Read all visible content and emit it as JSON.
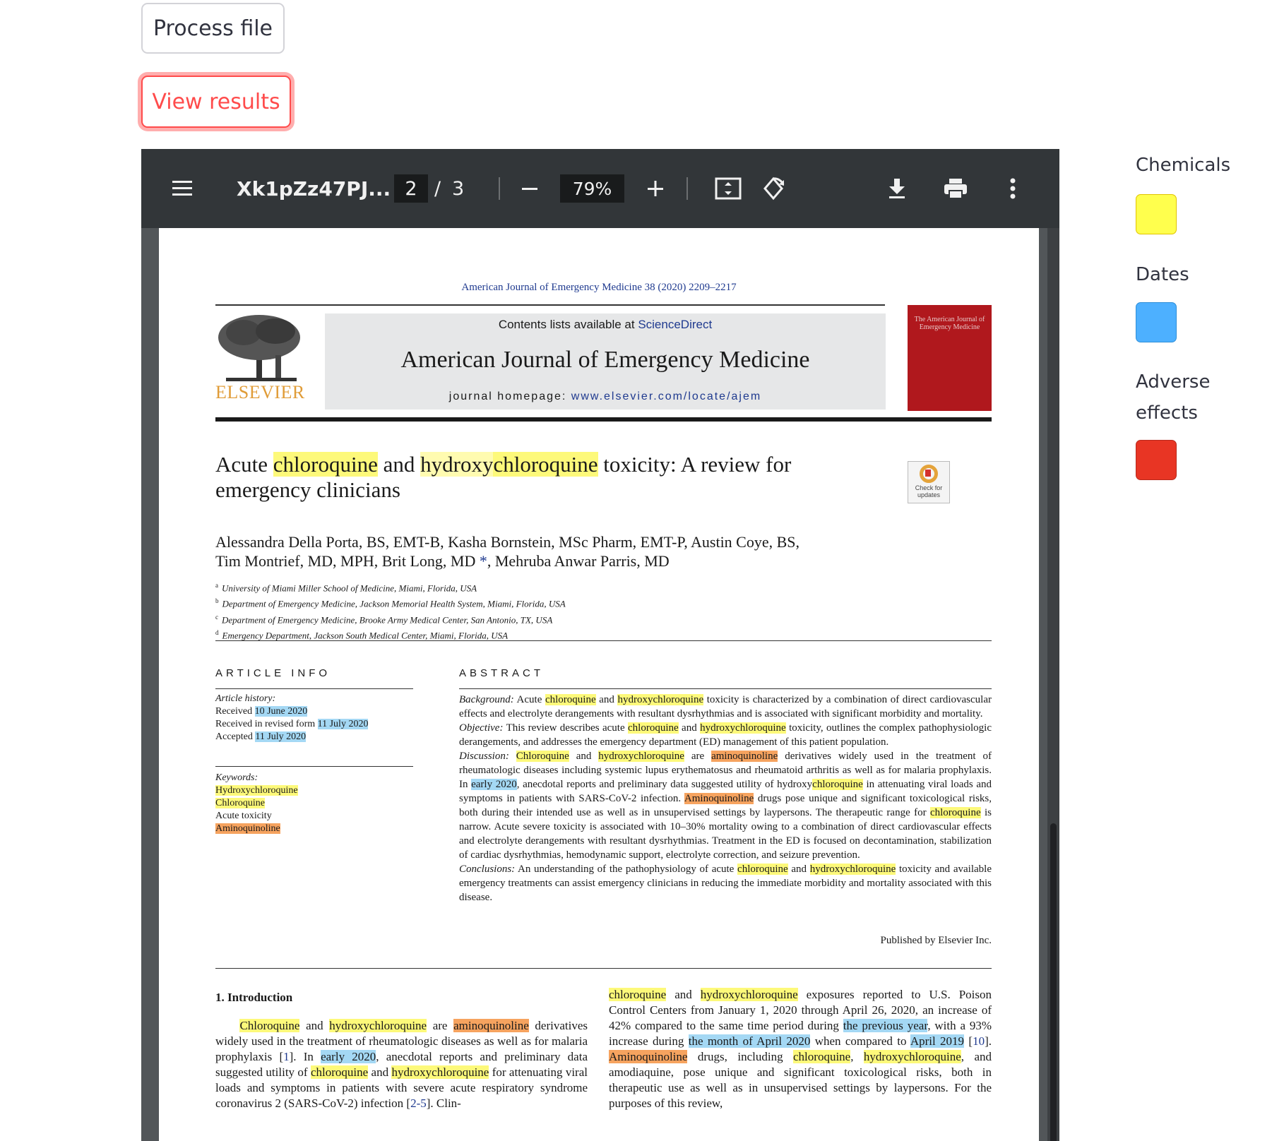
{
  "buttons": {
    "process_file": "Process file",
    "view_results": "View results"
  },
  "viewer": {
    "title": "Xk1pZz47PJ...",
    "current_page": "2",
    "page_separator": "/",
    "total_pages": "3",
    "zoom": "79%",
    "icons": [
      "menu-icon",
      "zoom-out-icon",
      "zoom-in-icon",
      "fit-page-icon",
      "rotate-icon",
      "download-icon",
      "print-icon",
      "more-options-icon"
    ]
  },
  "document": {
    "journal_ref": "American Journal of Emergency Medicine 38 (2020) 2209–2217",
    "contents_prefix": "Contents lists available at ",
    "contents_link": "ScienceDirect",
    "journal_name": "American Journal of Emergency Medicine",
    "homepage_prefix": "journal homepage: ",
    "homepage_link": "www.elsevier.com/locate/ajem",
    "publisher_logo": "ELSEVIER",
    "cover_text": "The American Journal of Emergency Medicine",
    "check_updates": "Check for updates",
    "title": {
      "p1": "Acute ",
      "chem1": "chloroquine",
      "p2": " and ",
      "chem2a": "hydroxy",
      "chem2b": "chloroquine",
      "p3": " toxicity: A review for emergency clinicians"
    },
    "authors": {
      "line1": "Alessandra Della Porta, BS, EMT-B, Kasha Bornstein, MSc Pharm, EMT-P, Austin Coye, BS,",
      "line2": "Tim Montrief, MD, MPH, Brit Long, MD",
      "star": " *",
      "line2b": ", Mehruba Anwar Parris, MD"
    },
    "affiliations": [
      {
        "sup": "a",
        "text": "University of Miami Miller School of Medicine, Miami, Florida, USA"
      },
      {
        "sup": "b",
        "text": "Department of Emergency Medicine, Jackson Memorial Health System, Miami, Florida, USA"
      },
      {
        "sup": "c",
        "text": "Department of Emergency Medicine, Brooke Army Medical Center, San Antonio, TX, USA"
      },
      {
        "sup": "d",
        "text": "Emergency Department, Jackson South Medical Center, Miami, Florida, USA"
      }
    ],
    "article_info_heading": "ARTICLE INFO",
    "abstract_heading": "ABSTRACT",
    "history": {
      "label": "Article history:",
      "received": "Received",
      "received_date": "10 June 2020",
      "revised": "Received in revised form",
      "revised_date": "11 July 2020",
      "accepted": "Accepted",
      "accepted_date": "11 July 2020"
    },
    "keywords": {
      "label": "Keywords:",
      "k1": "Hydroxychloroquine",
      "k2": "Chloroquine",
      "k3": "Acute toxicity",
      "k4": "Aminoquinoline"
    },
    "abstract": {
      "bg_label": "Background:",
      "bg1": " Acute ",
      "bg_c1": "chloroquine",
      "bg2": " and ",
      "bg_c2": "hydroxychloroquine",
      "bg3": " toxicity is characterized by a combination of direct cardiovascular effects and electrolyte derangements with resultant dysrhythmias and is associated with significant morbidity and mortality.",
      "obj_label": "Objective:",
      "obj1": " This review describes acute ",
      "obj_c1": "chloroquine",
      "obj2": " and ",
      "obj_c2": "hydroxychloroquine",
      "obj3": " toxicity, outlines the complex pathophysiologic derangements, and addresses the emergency department (ED) management of this patient population.",
      "disc_label": "Discussion:",
      "disc_c1": "Chloroquine",
      "disc1": " and ",
      "disc_c2": "hydroxychloroquine",
      "disc2": " are ",
      "disc_a1": "aminoquinoline",
      "disc3": " derivatives widely used in the treatment of rheumatologic diseases including systemic lupus erythematosus and rheumatoid arthritis as well as for malaria prophylaxis. In ",
      "disc_d1": "early 2020",
      "disc4": ", anecdotal reports and preliminary data suggested utility of hydroxy",
      "disc_c3": "chloroquine",
      "disc5": " in attenuating viral loads and symptoms in patients with SARS-CoV-2 infection. ",
      "disc_a2": "Aminoquinoline",
      "disc6": " drugs pose unique and significant toxicological risks, both during their intended use as well as in unsupervised settings by laypersons. The therapeutic range for ",
      "disc_c4": "chloroquine",
      "disc7": " is narrow. Acute severe toxicity is associated with 10–30% mortality owing to a combination of direct cardiovascular effects and electrolyte derangements with resultant dysrhythmias. Treatment in the ED is focused on decontamination, stabilization of cardiac dysrhythmias, hemodynamic support, electrolyte correction, and seizure prevention.",
      "conc_label": "Conclusions:",
      "conc1": " An understanding of the pathophysiology of acute ",
      "conc_c1": "chloroquine",
      "conc2": " and ",
      "conc_c2": "hydroxychloroquine",
      "conc3": " toxicity and available emergency treatments can assist emergency clinicians in reducing the immediate morbidity and mortality associated with this disease."
    },
    "published_by": "Published by Elsevier Inc.",
    "intro_heading": "1. Introduction",
    "intro_left": {
      "c1": "Chloroquine",
      "t1": " and ",
      "c2": "hydroxychloroquine",
      "t2": " are ",
      "a1": "aminoquinoline",
      "t3": " derivatives widely used in the treatment of rheumatologic diseases as well as for malaria prophylaxis [",
      "r1": "1",
      "t4": "]. In ",
      "d1": "early 2020",
      "t5": ", anecdotal reports and preliminary data suggested utility of ",
      "c3": "chloroquine",
      "t6": " and ",
      "c4": "hydroxychloroquine",
      "t7": " for attenuating viral loads and symptoms in patients with severe acute respiratory syndrome coronavirus 2 (SARS-CoV-2) infection [",
      "r2": "2-5",
      "t8": "]. Clin-"
    },
    "intro_right": {
      "c1": "chloroquine",
      "t1": " and ",
      "c2": "hydroxychloroquine",
      "t2": " exposures reported to U.S. Poison Control Centers from January 1, 2020 through April 26, 2020, an increase of 42% compared to the same time period during ",
      "d1": "the previous year",
      "t3": ", with a 93% increase during ",
      "d2": "the month of April 2020",
      "t4": " when compared to ",
      "d3": "April 2019",
      "t5": " [",
      "r1": "10",
      "t6": "]. ",
      "a1": "Aminoquinoline",
      "t7": " drugs, including ",
      "c3": "chloroquine",
      "t8": ", ",
      "c4": "hydroxychloroquine",
      "t9": ", and amodiaquine, pose unique and significant toxicological risks, both in therapeutic use as well as in unsupervised settings by laypersons. For the purposes of this review,"
    }
  },
  "legend": {
    "items": [
      {
        "label": "Chemicals",
        "color": "#ffff4d"
      },
      {
        "label": "Dates",
        "color": "#4db0ff"
      },
      {
        "label": "Adverse effects",
        "color": "#e83524"
      }
    ]
  }
}
